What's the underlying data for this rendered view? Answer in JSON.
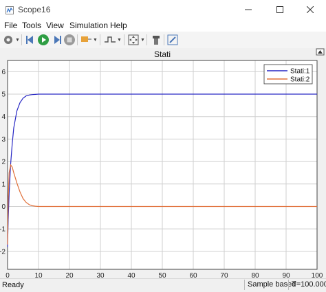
{
  "window": {
    "title": "Scope16",
    "minimize_icon": "minimize-icon",
    "maximize_icon": "maximize-icon",
    "close_icon": "close-icon"
  },
  "menu": {
    "file": "File",
    "tools": "Tools",
    "view": "View",
    "simulation": "Simulation",
    "help": "Help"
  },
  "toolbar": {
    "icons": [
      "settings-icon",
      "step-back-icon",
      "run-icon",
      "step-forward-icon",
      "stop-icon",
      "highlight-icon",
      "trigger-icon",
      "zoom-fit-icon",
      "pan-icon",
      "edit-icon"
    ]
  },
  "status": {
    "left": "Ready",
    "sample": "Sample based",
    "time": "T=100.000"
  },
  "colors": {
    "series1": "#2727c4",
    "series2": "#e0703a",
    "grid": "#cfcfcf"
  },
  "chart_data": {
    "type": "line",
    "title": "Stati",
    "xlabel": "",
    "ylabel": "",
    "xlim": [
      0,
      100
    ],
    "ylim": [
      -2.8,
      6.5
    ],
    "xticks": [
      "0",
      "10",
      "20",
      "30",
      "40",
      "50",
      "60",
      "70",
      "80",
      "90",
      "100"
    ],
    "yticks": [
      "-2",
      "-1",
      "0",
      "1",
      "2",
      "3",
      "4",
      "5",
      "6"
    ],
    "grid": true,
    "legend_position": "top-right",
    "series": [
      {
        "name": "Stati:1",
        "x": [
          0,
          0.2,
          0.5,
          1,
          1.5,
          2,
          3,
          4,
          5,
          6,
          7,
          8,
          9,
          10,
          15,
          20,
          30,
          50,
          100
        ],
        "y": [
          -1.8,
          -0.6,
          0.6,
          1.9,
          2.8,
          3.5,
          4.25,
          4.62,
          4.82,
          4.92,
          4.96,
          4.98,
          4.99,
          5.0,
          5.0,
          5.0,
          5.0,
          5.0,
          5.0
        ]
      },
      {
        "name": "Stati:2",
        "x": [
          0,
          0.2,
          0.5,
          1,
          1.5,
          2,
          3,
          4,
          5,
          6,
          7,
          8,
          9,
          10,
          15,
          20,
          30,
          50,
          100
        ],
        "y": [
          -1.7,
          0.3,
          1.5,
          1.85,
          1.75,
          1.5,
          1.05,
          0.65,
          0.35,
          0.18,
          0.08,
          0.03,
          0.01,
          0.0,
          0.0,
          0.0,
          0.0,
          0.0,
          0.0
        ]
      }
    ]
  }
}
